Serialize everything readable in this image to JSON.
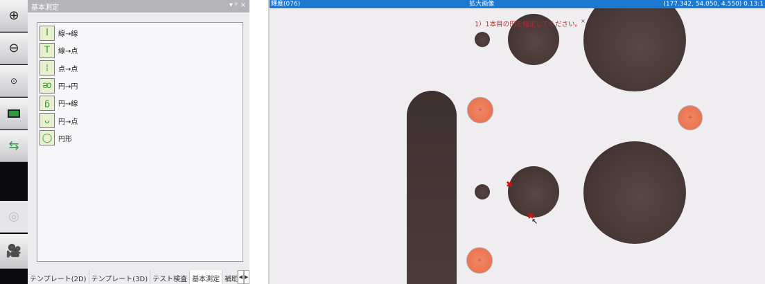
{
  "toolbar": {
    "buttons": [
      "zoom-in",
      "zoom-out",
      "zoom-1x",
      "fit-screen",
      "rotate",
      "disabled-device",
      "camera"
    ]
  },
  "panel": {
    "title": "基本測定",
    "header_icons": [
      "▾",
      "ᵖ",
      "×"
    ],
    "items": [
      {
        "label": "線→線",
        "icon": "I"
      },
      {
        "label": "線→点",
        "icon": "T"
      },
      {
        "label": "点→点",
        "icon": "⁞"
      },
      {
        "label": "円→円",
        "icon": "ᴔ"
      },
      {
        "label": "円→線",
        "icon": "ᵷ"
      },
      {
        "label": "円→点",
        "icon": "ᴗ"
      },
      {
        "label": "円形",
        "icon": "◯"
      }
    ],
    "tabs": [
      "テンプレート(2D)",
      "テンプレート(3D)",
      "テスト検査",
      "基本測定",
      "補助ツ-"
    ],
    "active_tab": "基本測定"
  },
  "image": {
    "left_title": "輝度(076)",
    "title": "拡大画像",
    "coords": "(177.342, 54.050, 4.550) 0.13:1",
    "message": "1）1本目の円を指定してください。",
    "close": "×"
  }
}
